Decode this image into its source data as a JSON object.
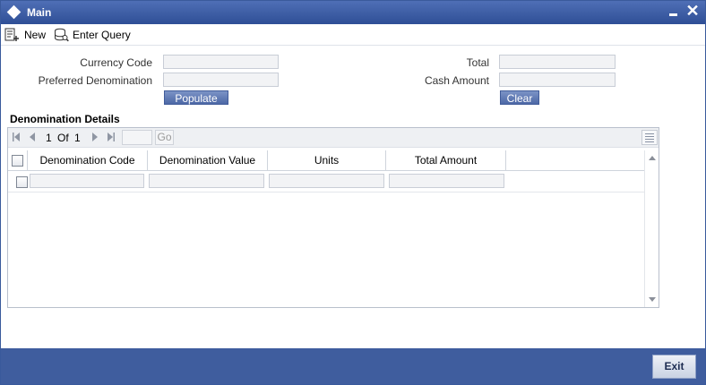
{
  "window": {
    "title": "Main",
    "close_glyph": "✕"
  },
  "toolbar": {
    "new_label": "New",
    "enter_query_label": "Enter Query"
  },
  "form": {
    "currency_code_label": "Currency Code",
    "currency_code_value": "",
    "preferred_denomination_label": "Preferred Denomination",
    "preferred_denomination_value": "",
    "total_label": "Total",
    "total_value": "",
    "cash_amount_label": "Cash Amount",
    "cash_amount_value": "",
    "populate_label": "Populate",
    "clear_label": "Clear"
  },
  "denomination_details": {
    "title": "Denomination Details",
    "pagination": {
      "current_page": "1",
      "of_label": "Of",
      "total_pages": "1",
      "go_label": "Go",
      "page_input_value": ""
    },
    "columns": [
      "Denomination Code",
      "Denomination Value",
      "Units",
      "Total Amount"
    ],
    "rows": [
      {
        "denomination_code": "",
        "denomination_value": "",
        "units": "",
        "total_amount": ""
      }
    ]
  },
  "footer": {
    "exit_label": "Exit"
  },
  "colors": {
    "title_bar": "#2f4f96",
    "footer": "#3f5d9e",
    "button_blue": "#4d68a6"
  },
  "icons": [
    "diamond-icon",
    "minimize-icon",
    "close-icon",
    "new-icon",
    "enter-query-icon",
    "first-page-icon",
    "prev-page-icon",
    "next-page-icon",
    "last-page-icon",
    "grid-menu-icon",
    "scroll-up-icon",
    "scroll-down-icon"
  ]
}
